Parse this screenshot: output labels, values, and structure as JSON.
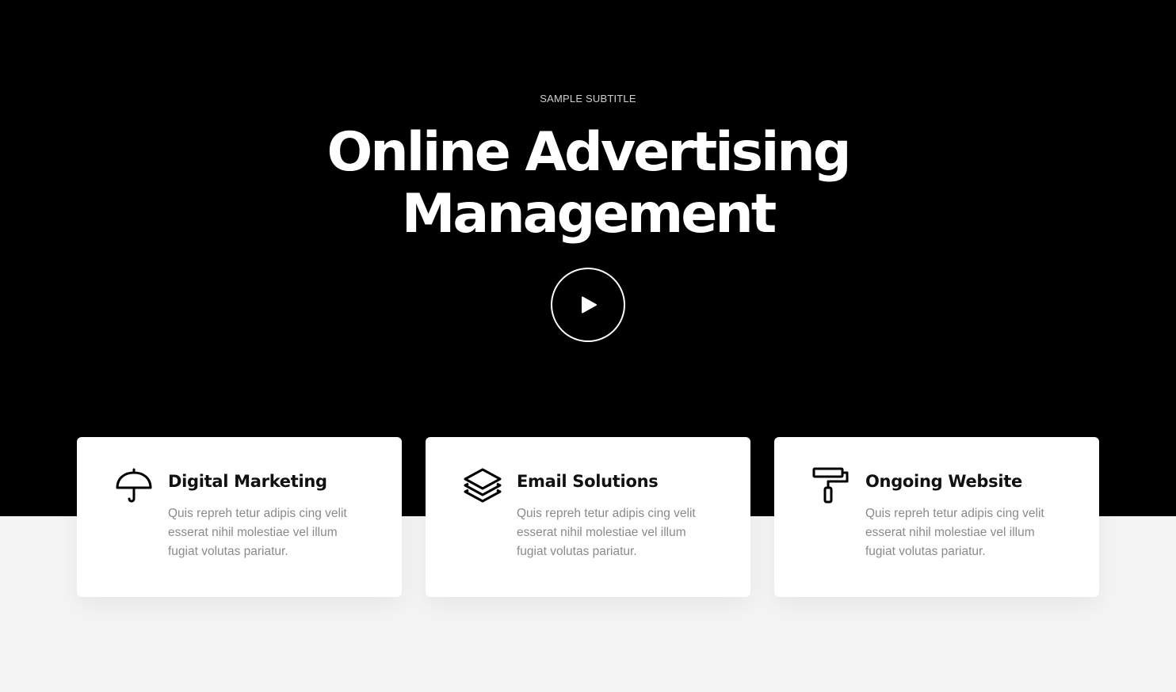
{
  "hero": {
    "subtitle": "SAMPLE SUBTITLE",
    "title_line1": "Online Advertising",
    "title_line2": "Management",
    "play_icon": "play-icon"
  },
  "colors": {
    "hero_bg": "#000000",
    "lower_bg": "#f4f4f4",
    "card_bg": "#ffffff",
    "accent": "#ffffff"
  },
  "cards": [
    {
      "icon": "umbrella-icon",
      "title": "Digital Marketing",
      "text": "Quis repreh tetur adipis cing velit esserat nihil molestiae vel illum fugiat volutas pariatur."
    },
    {
      "icon": "layers-icon",
      "title": "Email Solutions",
      "text": "Quis repreh tetur adipis cing velit esserat nihil molestiae vel illum fugiat volutas pariatur."
    },
    {
      "icon": "paint-roller-icon",
      "title": "Ongoing Website",
      "text": "Quis repreh tetur adipis cing velit esserat nihil molestiae vel illum fugiat volutas pariatur."
    }
  ]
}
